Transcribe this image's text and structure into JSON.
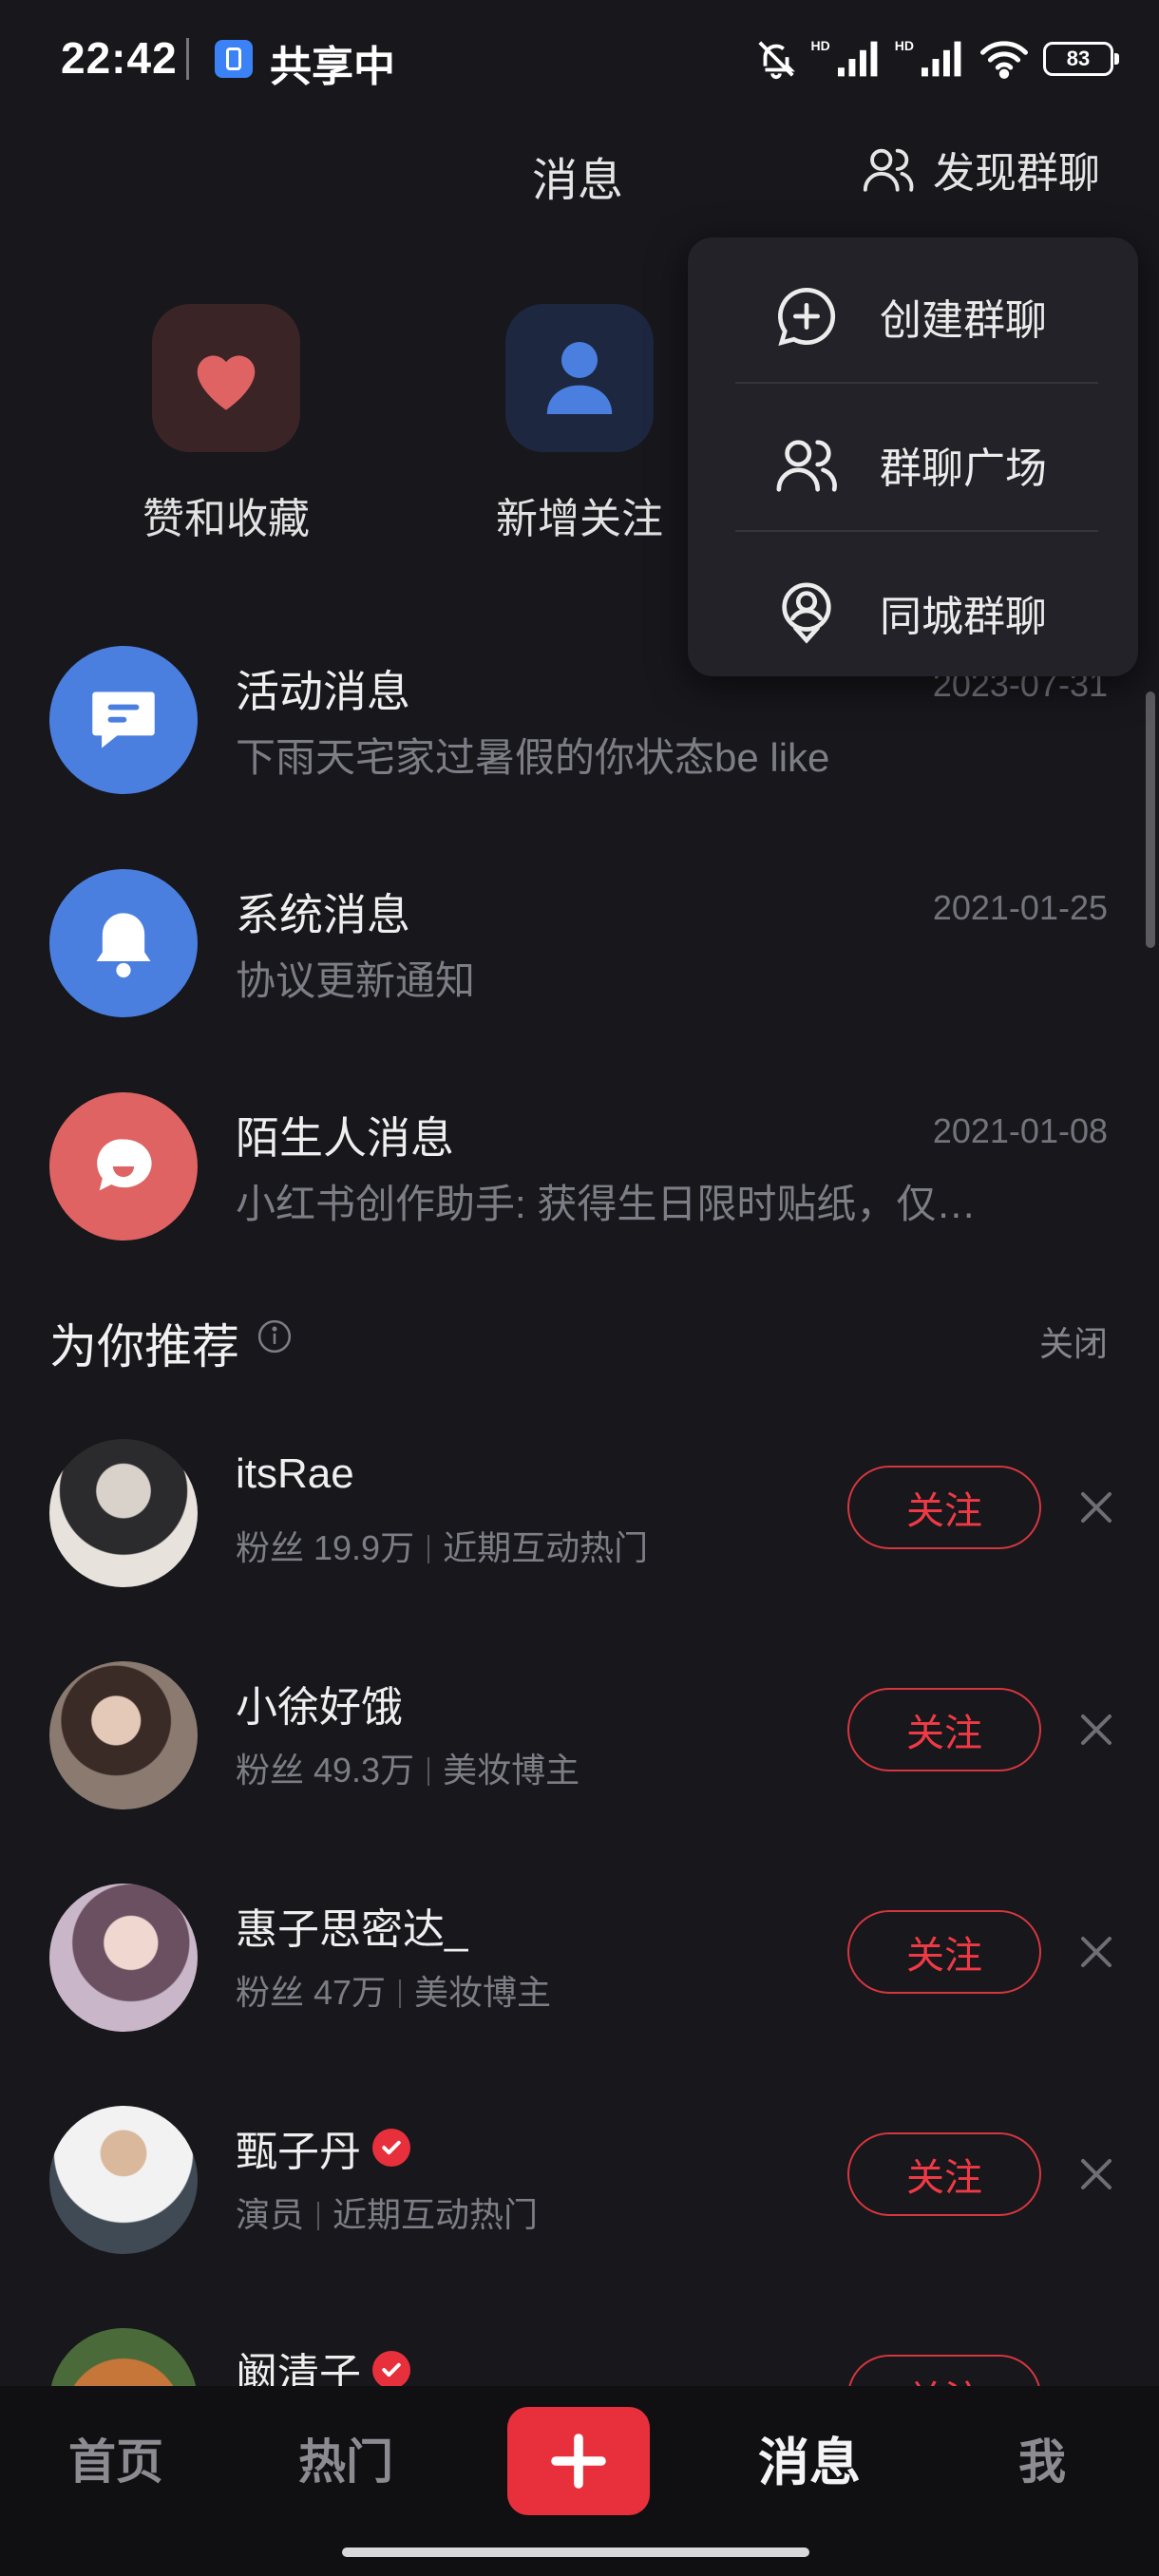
{
  "status_bar": {
    "time": "22:42",
    "sharing_label": "共享中",
    "battery": "83"
  },
  "header": {
    "title": "消息",
    "discover_group_label": "发现群聊"
  },
  "quick_tiles": [
    {
      "label": "赞和收藏",
      "icon": "heart-icon",
      "color": "#e06363"
    },
    {
      "label": "新增关注",
      "icon": "person-icon",
      "color": "#4a7fe0"
    }
  ],
  "dropdown_menu": {
    "items": [
      {
        "label": "创建群聊",
        "icon": "add-circle-chat-icon"
      },
      {
        "label": "群聊广场",
        "icon": "group-users-icon"
      },
      {
        "label": "同城群聊",
        "icon": "location-pin-icon"
      }
    ]
  },
  "messages": [
    {
      "title": "活动消息",
      "subtitle": "下雨天宅家过暑假的你状态be like",
      "date": "2023-07-31",
      "icon": "chat-bubble-icon",
      "color": "#4a7fe0"
    },
    {
      "title": "系统消息",
      "subtitle": "协议更新通知",
      "date": "2021-01-25",
      "icon": "bell-icon",
      "color": "#4a7fe0"
    },
    {
      "title": "陌生人消息",
      "subtitle": "小红书创作助手: 获得生日限时贴纸，仅…",
      "date": "2021-01-08",
      "icon": "stranger-chat-icon",
      "color": "#e06363"
    }
  ],
  "recommend": {
    "title": "为你推荐",
    "close_label": "关闭",
    "follow_label": "关注",
    "users": [
      {
        "name": "itsRae",
        "meta1": "粉丝 19.9万",
        "meta2": "近期互动热门",
        "verified": false
      },
      {
        "name": "小徐好饿",
        "meta1": "粉丝 49.3万",
        "meta2": "美妆博主",
        "verified": false
      },
      {
        "name": "惠子思密达_",
        "meta1": "粉丝 47万",
        "meta2": "美妆博主",
        "verified": false
      },
      {
        "name": "甄子丹",
        "meta1": "演员",
        "meta2": "近期互动热门",
        "verified": true
      },
      {
        "name": "阚清子",
        "meta1": "",
        "meta2": "",
        "verified": true
      }
    ]
  },
  "bottom_nav": {
    "home": "首页",
    "hot": "热门",
    "publish_icon": "plus-icon",
    "messages": "消息",
    "me": "我"
  },
  "colors": {
    "accent": "#e8303c",
    "background": "#17171c",
    "blue": "#4a7fe0"
  }
}
